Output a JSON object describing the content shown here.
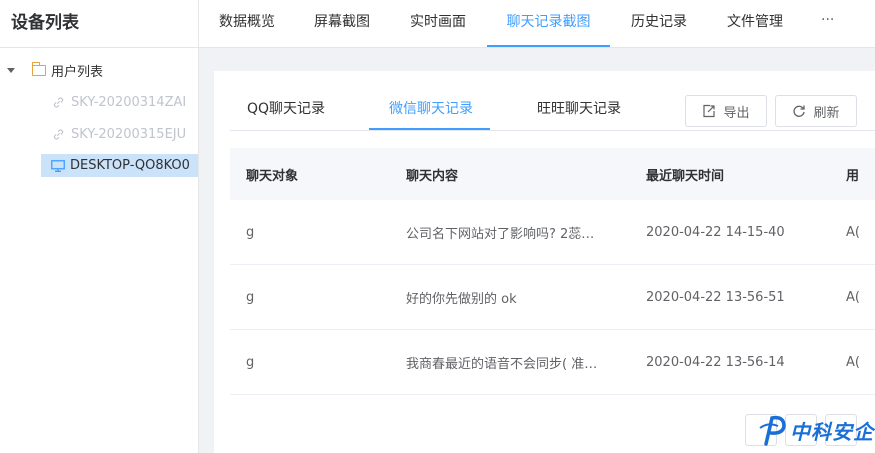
{
  "sidebar": {
    "title": "设备列表",
    "root_label": "用户列表",
    "devices": [
      {
        "label": "SKY-20200314ZAI",
        "status": "offline"
      },
      {
        "label": "SKY-20200315EJU",
        "status": "offline"
      },
      {
        "label": "DESKTOP-QO8KO0",
        "status": "online",
        "selected": true
      }
    ]
  },
  "top_tabs": [
    {
      "label": "数据概览"
    },
    {
      "label": "屏幕截图"
    },
    {
      "label": "实时画面"
    },
    {
      "label": "聊天记录截图",
      "active": true
    },
    {
      "label": "历史记录"
    },
    {
      "label": "文件管理"
    }
  ],
  "more_label": "···",
  "chat_tabs": [
    {
      "label": "QQ聊天记录"
    },
    {
      "label": "微信聊天记录",
      "active": true
    },
    {
      "label": "旺旺聊天记录"
    }
  ],
  "buttons": {
    "export": "导出",
    "refresh": "刷新"
  },
  "table": {
    "headers": [
      "聊天对象",
      "聊天内容",
      "最近聊天时间",
      "用"
    ],
    "rows": [
      {
        "target": "g",
        "content": "公司名下网站对了影响吗? 2蕊…",
        "time": "2020-04-22 14-15-40",
        "extra": "A("
      },
      {
        "target": "g",
        "content": "好的你先做别的 ok",
        "time": "2020-04-22 13-56-51",
        "extra": "A("
      },
      {
        "target": "g",
        "content": "我商春最近的语音不会同步( 准…",
        "time": "2020-04-22 13-56-14",
        "extra": "A("
      }
    ]
  },
  "watermark": "中科安企",
  "colors": {
    "accent": "#409eff",
    "selected_bg": "#cbe2fb",
    "page_bg": "#f0f2f5",
    "folder": "#e6a23c"
  }
}
